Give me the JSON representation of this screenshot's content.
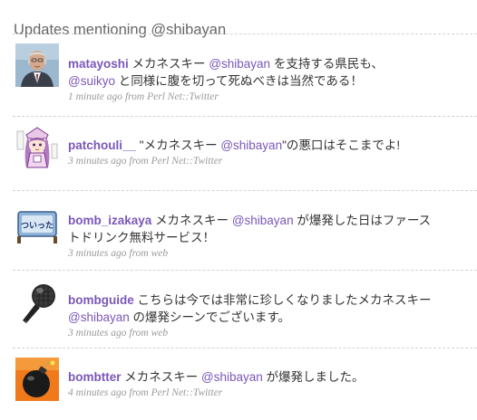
{
  "header": {
    "title": "Updates mentioning @shibayan"
  },
  "statuses": [
    {
      "screen_name": "matayoshi",
      "avatar_icon": "politician-portrait-avatar",
      "line1": {
        "pre": "メカネスキー ",
        "mention": "@shibayan",
        "post": " を支持する県民も、"
      },
      "line2": {
        "mention": "@suikyo",
        "post": " と同様に腹を切って死ぬべきは当然である！"
      },
      "time": "1 minute ago",
      "source_prefix": "from",
      "source": "Perl Net::Twitter"
    },
    {
      "screen_name": "patchouli__",
      "avatar_icon": "anime-girl-avatar",
      "line1": {
        "pre": "\"メカネスキー ",
        "mention": "@shibayan",
        "post": "\"の悪口はそこまでよ!"
      },
      "time": "3 minutes ago",
      "source_prefix": "from",
      "source": "Perl Net::Twitter"
    },
    {
      "screen_name": "bomb_izakaya",
      "avatar_icon": "izakaya-sign-avatar",
      "avatar_text": "ついった",
      "line1": {
        "pre": "メカネスキー ",
        "mention": "@shibayan",
        "post": " が爆発した日はファース"
      },
      "line2": {
        "post": "トドリンク無料サービス！"
      },
      "time": "3 minutes ago",
      "source_prefix": "from",
      "source": "web"
    },
    {
      "screen_name": "bombguide",
      "avatar_icon": "microphone-avatar",
      "line1": {
        "pre": "こちらは今では非常に珍しくなりましたメカネスキー"
      },
      "line2": {
        "mention": "@shibayan",
        "post": " の爆発シーンでございます。"
      },
      "time": "3 minutes ago",
      "source_prefix": "from",
      "source": "web"
    },
    {
      "screen_name": "bombtter",
      "avatar_icon": "bomb-avatar",
      "line1": {
        "pre": "メカネスキー ",
        "mention": "@shibayan",
        "post": " が爆発しました。"
      },
      "time": "4 minutes ago",
      "source_prefix": "from",
      "source": "Perl Net::Twitter"
    }
  ],
  "colors": {
    "link": "#7a57b8",
    "meta": "#9a9a9a",
    "divider": "#d3d3d3",
    "heading": "#666666"
  }
}
